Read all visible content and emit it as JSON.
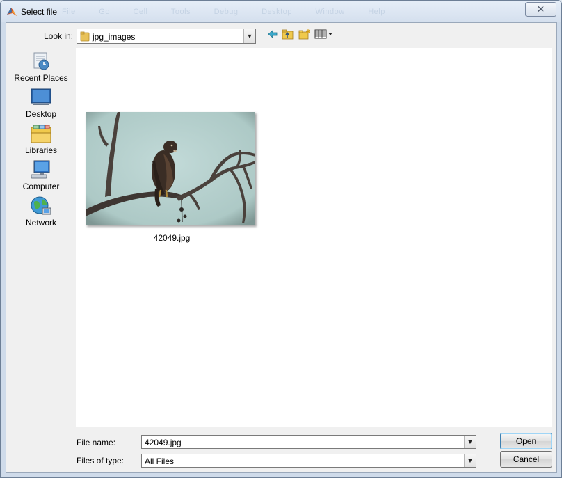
{
  "window": {
    "title": "Select file",
    "close_glyph": "✕"
  },
  "background_menu": [
    "File",
    "Go",
    "Cell",
    "Tools",
    "Debug",
    "Desktop",
    "Window",
    "Help"
  ],
  "lookin": {
    "label": "Look in:",
    "value": "jpg_images"
  },
  "toolbar": {
    "icons": [
      "back-arrow-icon",
      "up-folder-icon",
      "new-folder-icon",
      "view-menu-icon"
    ]
  },
  "places": [
    {
      "label": "Recent Places",
      "icon": "recent-places-icon"
    },
    {
      "label": "Desktop",
      "icon": "desktop-icon"
    },
    {
      "label": "Libraries",
      "icon": "libraries-icon"
    },
    {
      "label": "Computer",
      "icon": "computer-icon"
    },
    {
      "label": "Network",
      "icon": "network-icon"
    }
  ],
  "files": [
    {
      "name": "42049.jpg",
      "thumbnail": "bird-on-branch-photo"
    }
  ],
  "filename": {
    "label": "File name:",
    "value": "42049.jpg"
  },
  "filetype": {
    "label": "Files of type:",
    "value": "All Files"
  },
  "buttons": {
    "open": "Open",
    "cancel": "Cancel"
  },
  "colors": {
    "titlebar": "#dce6f2",
    "list_bg": "#ffffff",
    "photo_sky": "#b9d2cf"
  }
}
